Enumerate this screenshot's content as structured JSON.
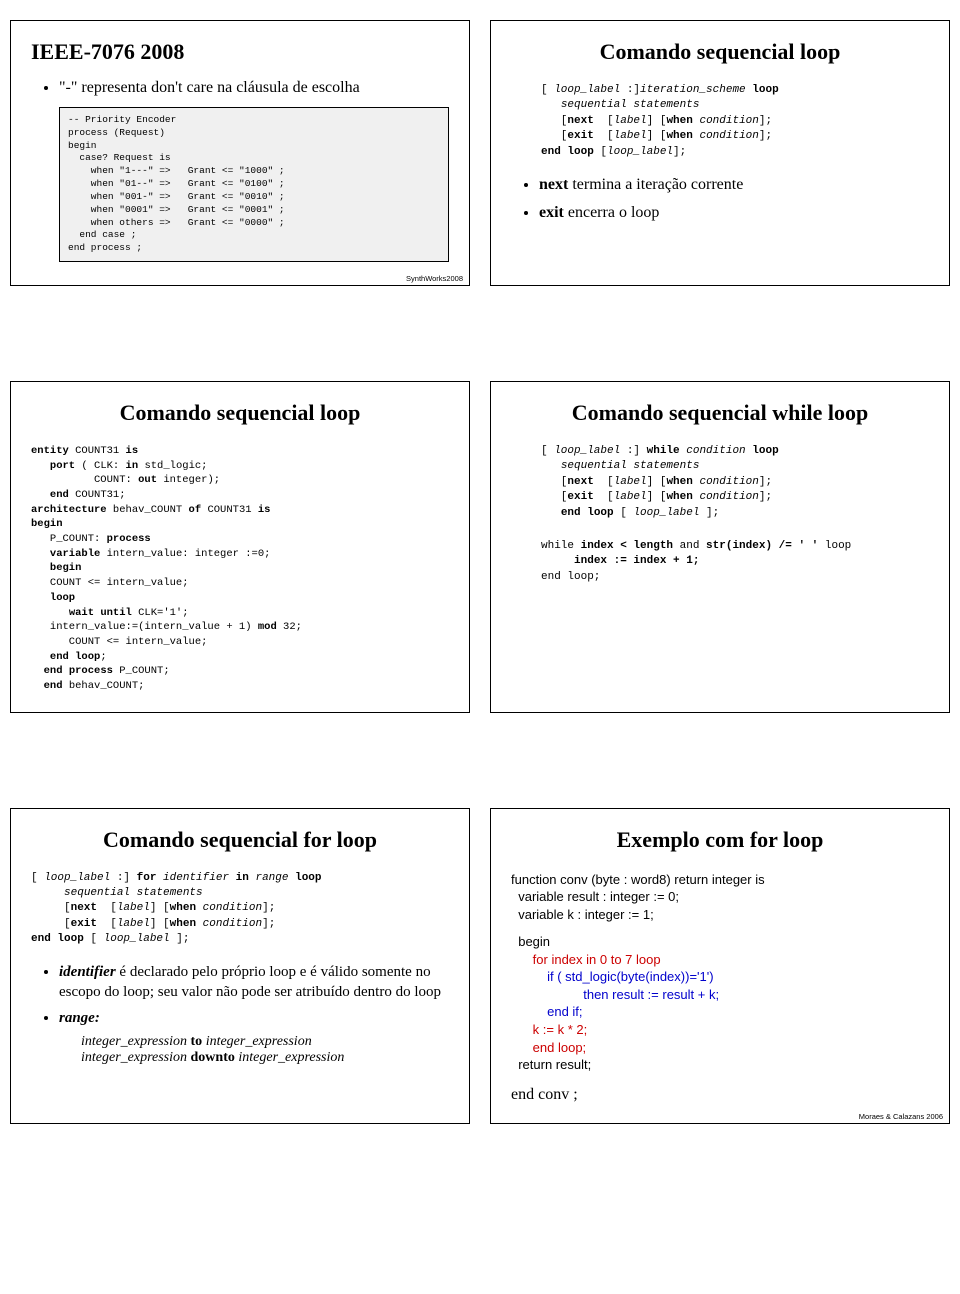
{
  "row1": {
    "left": {
      "title": "IEEE-7076 2008",
      "bullet": "\"-\" representa don't care na cláusula de escolha",
      "codebox": "-- Priority Encoder\nprocess (Request)\nbegin\n  case? Request is\n    when \"1---\" =>   Grant <= \"1000\" ;\n    when \"01--\" =>   Grant <= \"0100\" ;\n    when \"001-\" =>   Grant <= \"0010\" ;\n    when \"0001\" =>   Grant <= \"0001\" ;\n    when others =>   Grant <= \"0000\" ;\n  end case ;\nend process ;",
      "credit": "SynthWorks2008"
    },
    "right": {
      "title": "Comando sequencial loop",
      "syntax": "[ loop_label :]iteration_scheme loop\n   sequential statements\n   [next  [label] [when condition];\n   [exit  [label] [when condition];\nend loop [loop_label];",
      "b1pre": "next",
      "b1post": " termina a iteração corrente",
      "b2pre": "exit",
      "b2post": " encerra o loop"
    }
  },
  "row2": {
    "left": {
      "title": "Comando sequencial loop",
      "code": "entity COUNT31 is\n   port ( CLK: in std_logic;\n          COUNT: out integer);\n   end COUNT31;\narchitecture behav_COUNT of COUNT31 is\nbegin\n   P_COUNT: process\n   variable intern_value: integer :=0;\n   begin\n   COUNT <= intern_value;\n   loop\n      wait until CLK='1';\n   intern_value:=(intern_value + 1) mod 32;\n      COUNT <= intern_value;\n   end loop;\n  end process P_COUNT;\n  end behav_COUNT;"
    },
    "right": {
      "title": "Comando sequencial while loop",
      "syntax": "[ loop_label :] while condition loop\n   sequential statements\n   [next  [label] [when condition];\n   [exit  [label] [when condition];\n   end loop [ loop_label ];",
      "example": "while index < length and str(index) /= ' ' loop\n     index := index + 1;\nend loop;"
    }
  },
  "row3": {
    "left": {
      "title": "Comando sequencial for loop",
      "syntax": "[ loop_label :] for identifier in range loop\n     sequential statements\n     [next  [label] [when condition];\n     [exit  [label] [when condition];\nend loop [ loop_label ];",
      "b1": "identifier é declarado pelo próprio loop e é válido somente no escopo do loop; seu valor não pode ser atribuído dentro do loop",
      "b2": "range:",
      "r1a": "integer_expression",
      "r1b": " to ",
      "r1c": "integer_expression",
      "r2a": "integer_expression",
      "r2b": " downto ",
      "r2c": "integer_expression"
    },
    "right": {
      "title": "Exemplo com for loop",
      "l1": "function conv (byte : word8) return integer is",
      "l2": "  variable result : integer := 0;",
      "l3": "  variable k : integer := 1;",
      "l4": "  begin",
      "l5": "      for index in 0 to 7 loop",
      "l6": "          if ( std_logic(byte(index))='1')",
      "l7": "                    then result := result + k;",
      "l8": "          end if;",
      "l9": "      k := k * 2;",
      "l10": "      end loop;",
      "l11": "  return result;",
      "l12": "end conv ;",
      "credit": "Moraes & Calazans 2006"
    }
  }
}
